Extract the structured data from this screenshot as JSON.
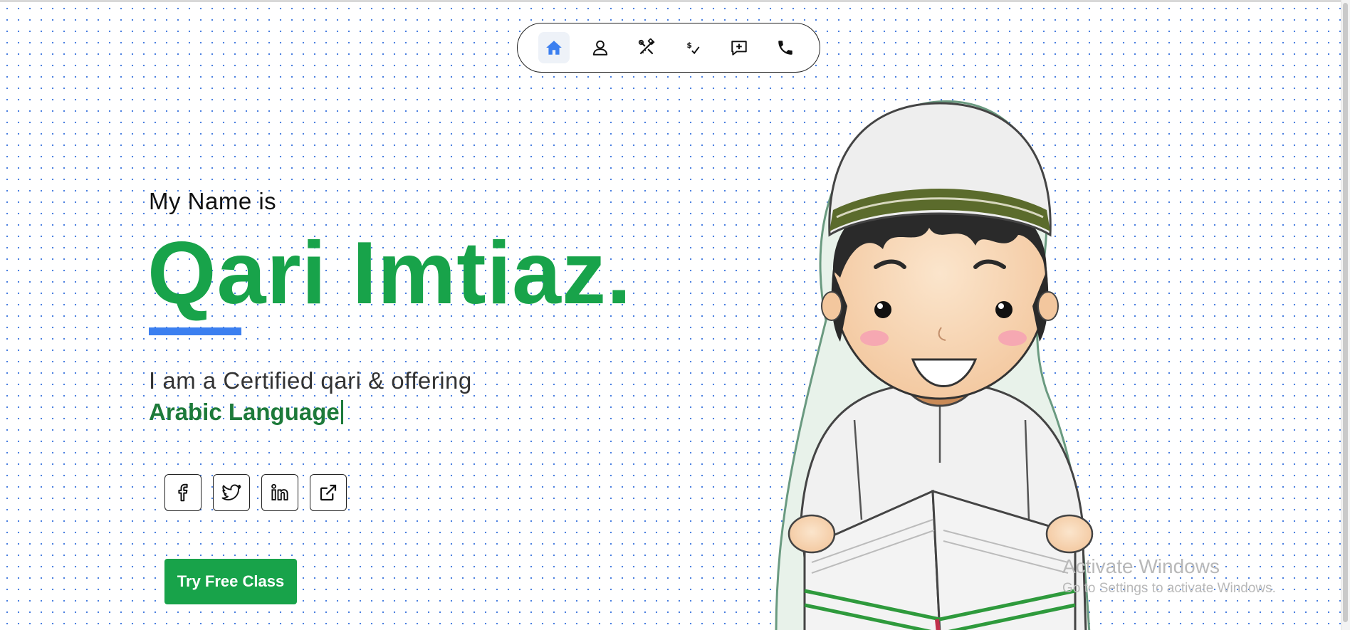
{
  "nav": {
    "items": [
      {
        "icon": "home-icon",
        "active": true
      },
      {
        "icon": "user-icon",
        "active": false
      },
      {
        "icon": "tools-icon",
        "active": false
      },
      {
        "icon": "dollar-check-icon",
        "active": false
      },
      {
        "icon": "message-plus-icon",
        "active": false
      },
      {
        "icon": "phone-icon",
        "active": false
      }
    ]
  },
  "hero": {
    "intro": "My Name is",
    "name": "Qari Imtiaz.",
    "tagline": "I am a Certified qari & offering",
    "typed": "Arabic Language"
  },
  "socials": [
    {
      "icon": "facebook-icon"
    },
    {
      "icon": "twitter-icon"
    },
    {
      "icon": "linkedin-icon"
    },
    {
      "icon": "external-link-icon"
    }
  ],
  "cta": {
    "label": "Try Free Class"
  },
  "watermark": {
    "line1": "Activate Windows",
    "line2": "Go to Settings to activate Windows."
  },
  "colors": {
    "brand_green": "#18a34a",
    "accent_blue": "#3b7ff0",
    "typed_green": "#1d7a3a"
  }
}
